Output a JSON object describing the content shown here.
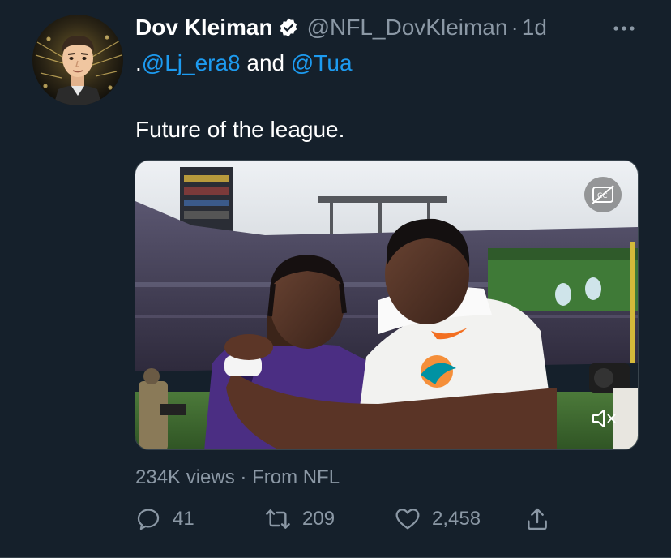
{
  "tweet": {
    "author": {
      "display_name": "Dov Kleiman",
      "handle": "@NFL_DovKleiman",
      "verified": true,
      "avatar_icon": "cartoon-avatar"
    },
    "separator": "·",
    "time": "1d",
    "text": {
      "prefix": ".",
      "mention_1": "@Lj_era8",
      "joiner": " and ",
      "mention_2": "@Tua",
      "body": "Future of the league."
    },
    "media": {
      "type": "video",
      "description_icon": "football-players-embrace",
      "cc_icon": "closed-captions-off-icon",
      "mute_icon": "muted-speaker-icon"
    },
    "views": {
      "count_text": "234K views",
      "separator": " · ",
      "source_text": "From NFL"
    },
    "actions": {
      "replies": "41",
      "retweets": "209",
      "likes": "2,458"
    }
  },
  "colors": {
    "background": "#15202b",
    "text_primary": "#ffffff",
    "text_secondary": "#8b98a5",
    "link": "#1d9bf0",
    "border": "#38444d"
  }
}
